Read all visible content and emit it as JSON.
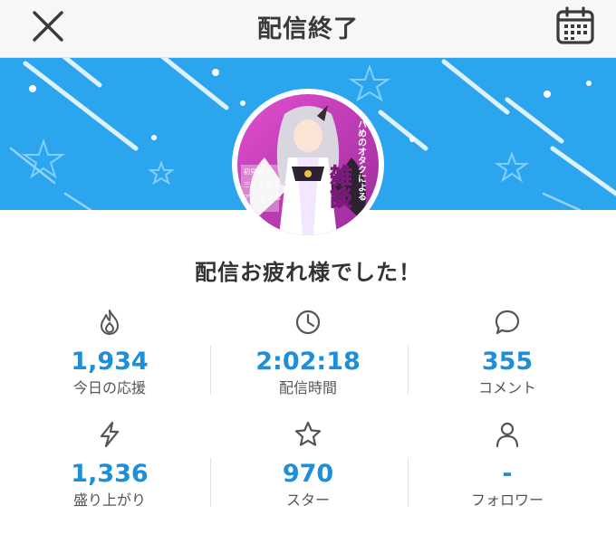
{
  "header": {
    "title": "配信終了",
    "close_icon": "close-icon",
    "calendar_icon": "calendar-icon"
  },
  "banner": {
    "background_color": "#2ba6ee",
    "avatar_text": {
      "vertical_main": "ヤバめのオタクによる",
      "big": "雑談",
      "small_line1": "初見",
      "small_line2": "ROM",
      "small_line3": "三人 大 歓迎",
      "small_line4": "アニ 山 有 者"
    }
  },
  "message": "配信お疲れ様でした！",
  "stats": [
    {
      "icon": "flame-icon",
      "value": "1,934",
      "label": "今日の応援"
    },
    {
      "icon": "clock-icon",
      "value": "2:02:18",
      "label": "配信時間"
    },
    {
      "icon": "comment-icon",
      "value": "355",
      "label": "コメント"
    },
    {
      "icon": "lightning-icon",
      "value": "1,336",
      "label": "盛り上がり"
    },
    {
      "icon": "star-icon",
      "value": "970",
      "label": "スター"
    },
    {
      "icon": "person-icon",
      "value": "-",
      "label": "フォロワー"
    }
  ],
  "colors": {
    "accent": "#1b8fd9",
    "banner": "#2ba6ee",
    "avatar_bg": "#c23ab5"
  }
}
